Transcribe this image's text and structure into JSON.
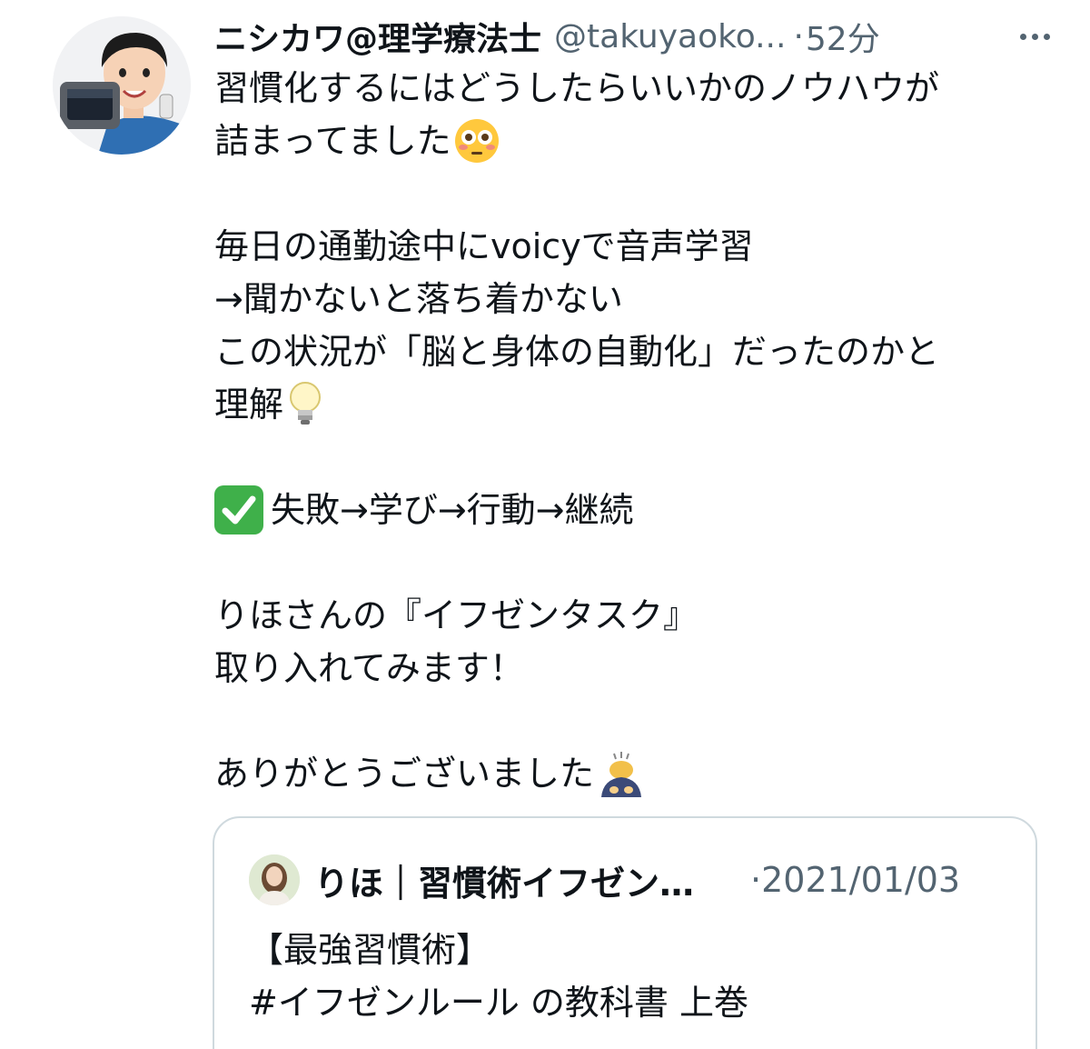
{
  "tweet": {
    "author_name": "ニシカワ@理学療法士",
    "handle": "@takuyaoko...",
    "separator": "·",
    "time": "52分",
    "lines": [
      "習慣化するにはどうしたらいいかのノウハウが",
      "詰まってました",
      "",
      "毎日の通勤途中にvoicyで音声学習",
      "→聞かないと落ち着かない",
      "この状況が「脳と身体の自動化」だったのかと",
      "理解",
      "",
      "失敗→学び→行動→継続",
      "",
      "りほさんの『イフゼンタスク』",
      "取り入れてみます！",
      "",
      "ありがとうございました"
    ],
    "emojis": {
      "line2": "flushed-face-emoji",
      "line7": "light-bulb-emoji",
      "line9": "check-mark-button-emoji",
      "line14": "person-bowing-emoji"
    }
  },
  "quoted_tweet": {
    "author_name": "りほ｜習慣術イフゼン…",
    "separator": "·",
    "date": "2021/01/03",
    "lines": [
      "【最強習慣術】",
      "#イフゼンルール の教科書 上巻"
    ]
  },
  "colors": {
    "text": "#0f1419",
    "secondary": "#536471",
    "border": "#cfd9de",
    "check_green": "#3fb04a"
  }
}
